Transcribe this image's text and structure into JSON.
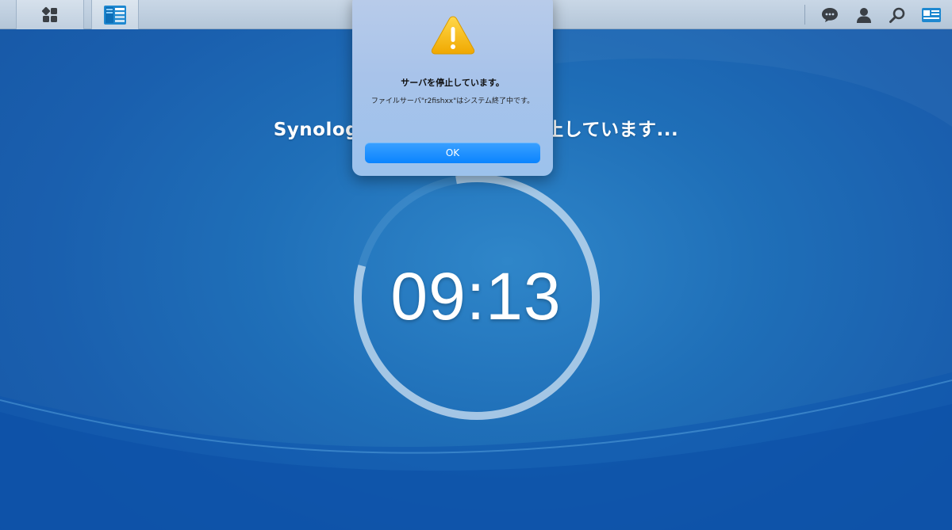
{
  "desktop": {
    "shutdown_title": "Synology DiskStation は停止しています...",
    "countdown": "09:13",
    "countdown_progress": 0.82
  },
  "taskbar": {
    "main_menu_icon": "grid-icon",
    "app_icon": "control-panel-icon",
    "right_icons": [
      "chat-icon",
      "user-icon",
      "search-icon",
      "widgets-icon"
    ]
  },
  "dialog": {
    "icon": "warning-icon",
    "title": "サーバを停止しています。",
    "message": "ファイルサーバ\"r2fishxx\"はシステム終了中です。",
    "ok_label": "OK"
  },
  "colors": {
    "accent": "#0a84ff",
    "background": "#1f6fb8",
    "warning": "#f5b800"
  }
}
